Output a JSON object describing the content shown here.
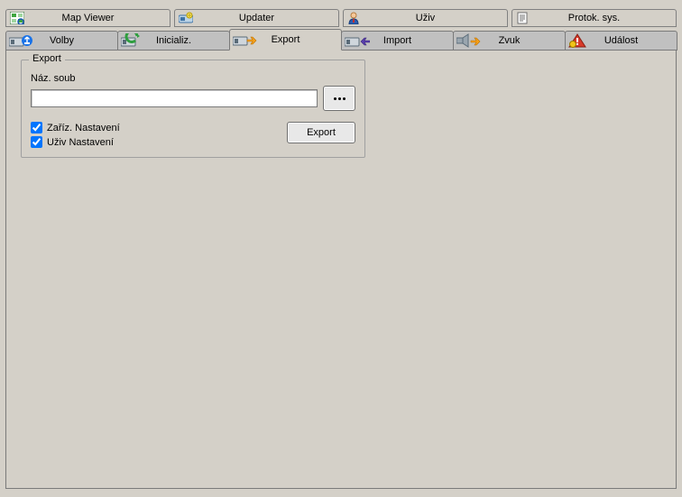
{
  "top_tabs": {
    "map_viewer": "Map Viewer",
    "updater": "Updater",
    "uziv": "Uživ",
    "protok": "Protok. sys."
  },
  "sub_tabs": {
    "volby": "Volby",
    "inicializ": "Inicializ.",
    "export": "Export",
    "import": "Import",
    "zvuk": "Zvuk",
    "udalost": "Událost"
  },
  "export_panel": {
    "group_title": "Export",
    "file_label": "Náz. soub",
    "file_value": "",
    "check_device": "Zaříz. Nastavení",
    "check_user": "Uživ Nastavení",
    "export_button": "Export"
  }
}
